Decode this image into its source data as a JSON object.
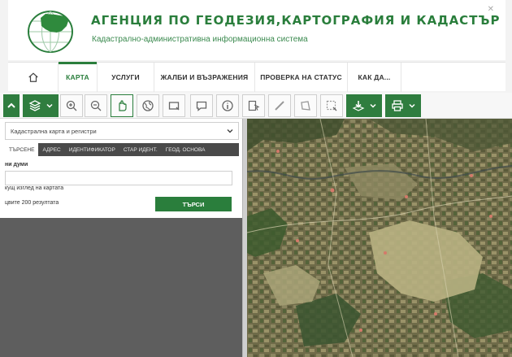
{
  "header": {
    "title": "АГЕНЦИЯ ПО ГЕОДЕЗИЯ,КАРТОГРАФИЯ И КАДАСТЪР",
    "subtitle": "Кадастрално-административна информационна система",
    "logo_icon": "globe-bulgaria-logo",
    "corner_icon": "close-icon"
  },
  "nav": {
    "home_icon": "home-icon",
    "items": [
      {
        "label": "КАРТА",
        "active": true
      },
      {
        "label": "УСЛУГИ"
      },
      {
        "label": "ЖАЛБИ И ВЪЗРАЖЕНИЯ"
      },
      {
        "label": "ПРОВЕРКА НА СТАТУС"
      },
      {
        "label": "КАК ДА..."
      }
    ]
  },
  "toolbar": {
    "icons": [
      "collapse-up-icon",
      "layers-icon",
      "zoom-in-icon",
      "zoom-out-icon",
      "pan-hand-icon",
      "globe-icon",
      "select-rectangle-icon",
      "comment-icon",
      "info-icon",
      "identify-icon",
      "measure-distance-icon",
      "measure-area-icon",
      "select-area-icon",
      "download-icon",
      "print-icon"
    ],
    "accent_color": "#2f7d3f"
  },
  "panel": {
    "layer_select": "Кадастрална карта и регистри",
    "tabs": [
      "ТЪРСЕНЕ",
      "АДРЕС",
      "ИДЕНТИФИКАТОР",
      "СТАР ИДЕНТ.",
      "ГЕОД. ОСНОВА"
    ],
    "search_label": "ни думи",
    "search_value": "",
    "option_current_view": "кущ изглед на картата",
    "option_first_200": "цвите 200 резултата",
    "search_button": "ТЪРСИ"
  }
}
